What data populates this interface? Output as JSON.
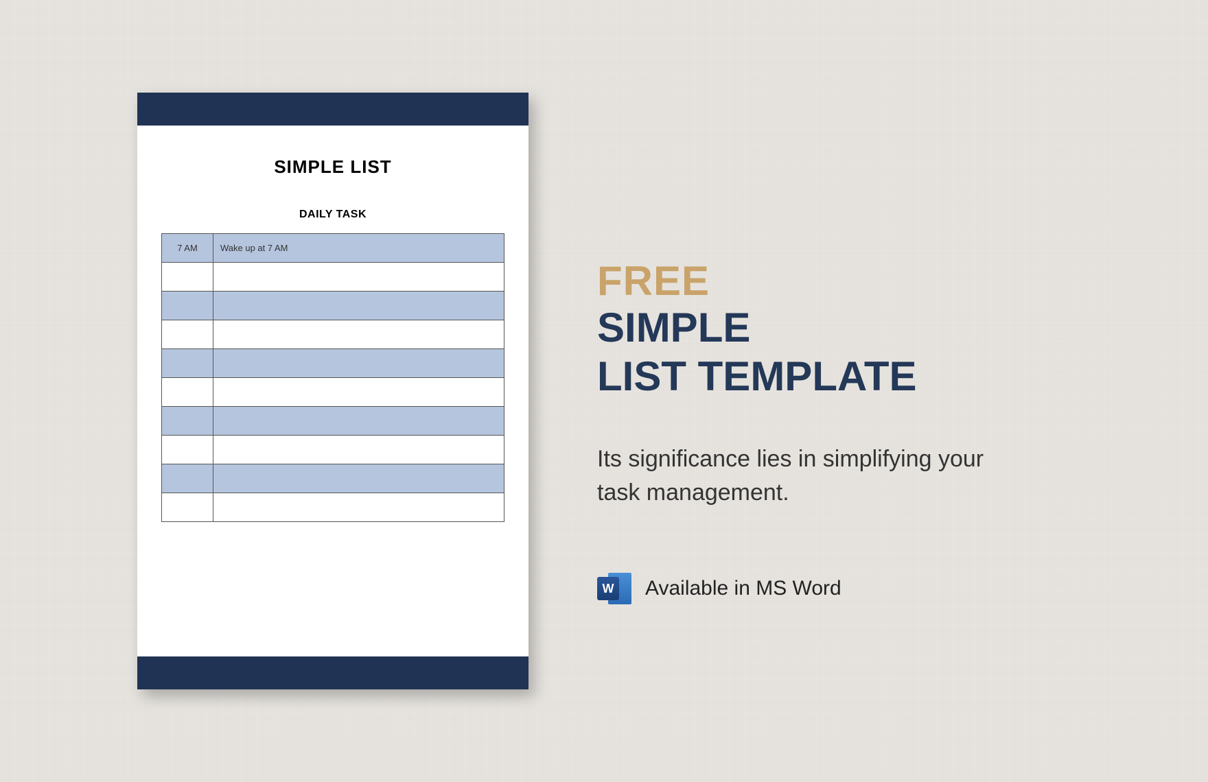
{
  "document": {
    "title": "SIMPLE LIST",
    "subtitle": "DAILY TASK",
    "rows": [
      {
        "time": "7 AM",
        "task": "Wake up  at 7 AM",
        "shaded": true
      },
      {
        "time": "",
        "task": "",
        "shaded": false
      },
      {
        "time": "",
        "task": "",
        "shaded": true
      },
      {
        "time": "",
        "task": "",
        "shaded": false
      },
      {
        "time": "",
        "task": "",
        "shaded": true
      },
      {
        "time": "",
        "task": "",
        "shaded": false
      },
      {
        "time": "",
        "task": "",
        "shaded": true
      },
      {
        "time": "",
        "task": "",
        "shaded": false
      },
      {
        "time": "",
        "task": "",
        "shaded": true
      },
      {
        "time": "",
        "task": "",
        "shaded": false
      }
    ]
  },
  "promo": {
    "badge": "FREE",
    "title_line1": "SIMPLE",
    "title_line2": "LIST TEMPLATE",
    "description": "Its significance lies in simplifying your task management.",
    "availability": "Available in MS Word",
    "word_letter": "W"
  },
  "colors": {
    "accent_gold": "#c9a36a",
    "navy": "#243858",
    "dark_bar": "#203354",
    "row_shade": "#b5c5de"
  }
}
